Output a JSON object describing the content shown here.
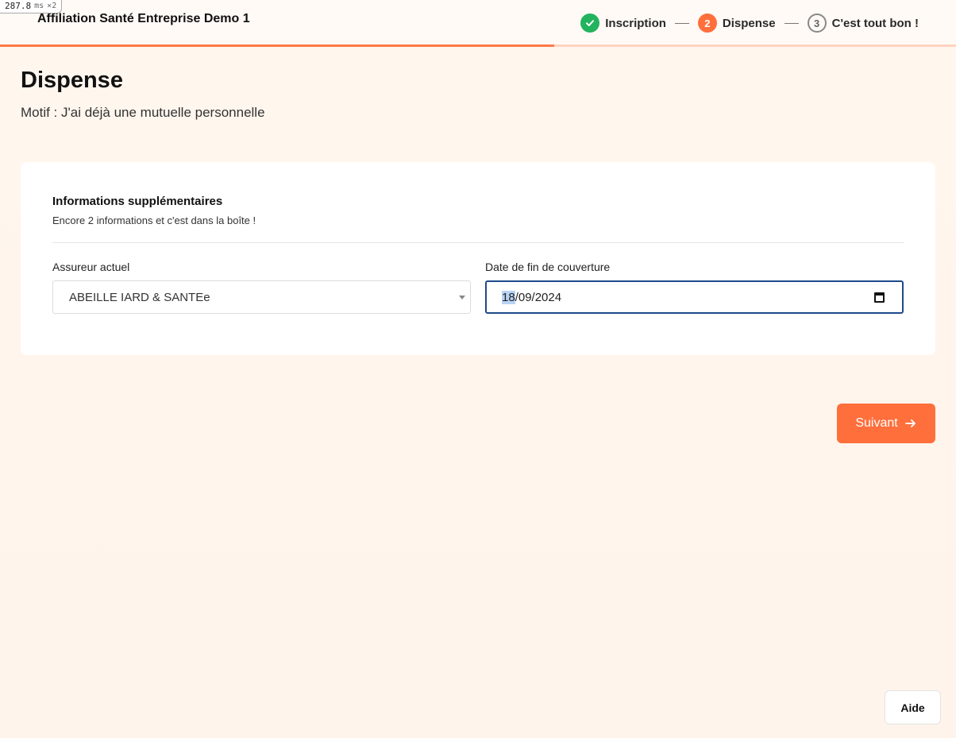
{
  "debug": {
    "timing_value": "287.8",
    "timing_unit": "ms",
    "multiplier": "×2"
  },
  "header": {
    "title": "Affiliation Santé Entreprise Demo 1",
    "steps": [
      {
        "number": "✓",
        "label": "Inscription",
        "state": "done"
      },
      {
        "number": "2",
        "label": "Dispense",
        "state": "active"
      },
      {
        "number": "3",
        "label": "C'est tout bon !",
        "state": "todo"
      }
    ],
    "progress_fraction": 0.58
  },
  "page": {
    "title": "Dispense",
    "subtitle": "Motif : J'ai déjà une mutuelle personnelle"
  },
  "card": {
    "title": "Informations supplémentaires",
    "subtitle": "Encore 2 informations et c'est dans la boîte !",
    "insurer": {
      "label": "Assureur actuel",
      "value": "ABEILLE IARD & SANTEe"
    },
    "end_date": {
      "label": "Date de fin de couverture",
      "day": "18",
      "rest": "/09/2024"
    }
  },
  "actions": {
    "next_label": "Suivant",
    "help_label": "Aide"
  },
  "colors": {
    "accent": "#ff6f3c",
    "success": "#22b35e",
    "focus": "#1e4a8a"
  },
  "icons": {
    "done_step": "check-icon",
    "next": "arrow-right-icon",
    "date": "calendar-icon"
  }
}
